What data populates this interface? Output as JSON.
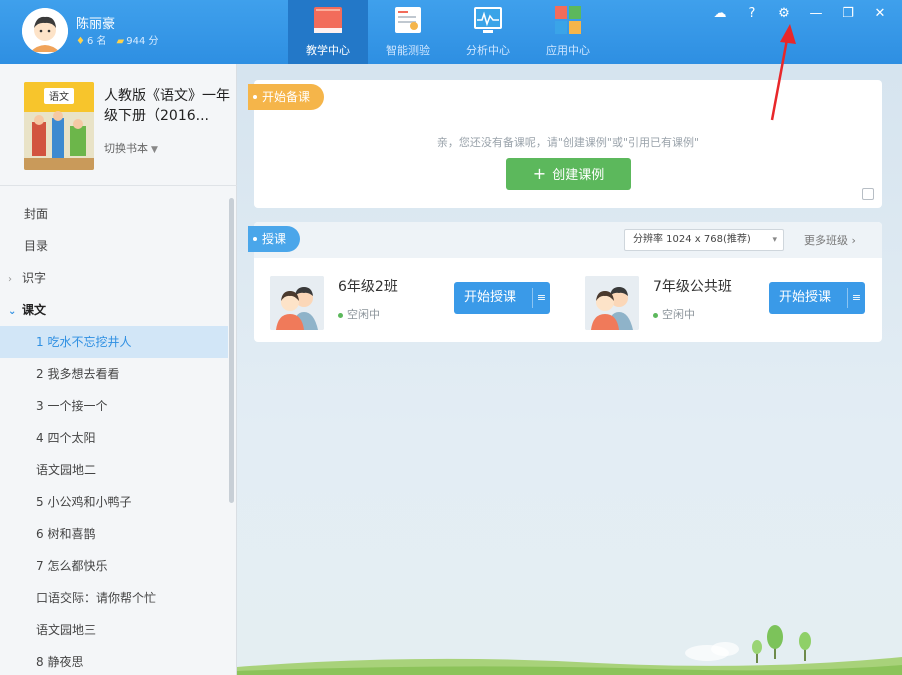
{
  "user": {
    "name": "陈丽豪",
    "stat1": "6 名",
    "stat2": "944 分"
  },
  "nav": [
    {
      "label": "教学中心",
      "active": true
    },
    {
      "label": "智能测验",
      "active": false
    },
    {
      "label": "分析中心",
      "active": false
    },
    {
      "label": "应用中心",
      "active": false
    }
  ],
  "window": {
    "cloud": "☁",
    "help": "?",
    "settings": "⚙",
    "minimize": "—",
    "restore": "❐",
    "close": "✕"
  },
  "book": {
    "title": "人教版《语文》一年级下册（2016...",
    "switch_label": "切换书本",
    "cover_text": "语文"
  },
  "toc": [
    {
      "label": "封面",
      "kind": "plain"
    },
    {
      "label": "目录",
      "kind": "plain"
    },
    {
      "label": "识字",
      "kind": "section",
      "arrow": "›"
    },
    {
      "label": "课文",
      "kind": "section-open",
      "arrow": "⌄"
    },
    {
      "label": "1 吃水不忘挖井人",
      "kind": "lesson-selected"
    },
    {
      "label": "2 我多想去看看",
      "kind": "lesson"
    },
    {
      "label": "3 一个接一个",
      "kind": "lesson"
    },
    {
      "label": "4 四个太阳",
      "kind": "lesson"
    },
    {
      "label": "语文园地二",
      "kind": "lesson"
    },
    {
      "label": "5 小公鸡和小鸭子",
      "kind": "lesson"
    },
    {
      "label": "6 树和喜鹊",
      "kind": "lesson"
    },
    {
      "label": "7 怎么都快乐",
      "kind": "lesson"
    },
    {
      "label": "口语交际：请你帮个忙",
      "kind": "lesson"
    },
    {
      "label": "语文园地三",
      "kind": "lesson"
    },
    {
      "label": "8 静夜思",
      "kind": "lesson"
    }
  ],
  "prep": {
    "ribbon": "开始备课",
    "hint": "亲，您还没有备课呢，请\"创建课例\"或\"引用已有课例\"",
    "create_label": "创建课例",
    "plus": "+"
  },
  "teach": {
    "ribbon": "授课",
    "resolution": "分辨率 1024 x 768(推荐)",
    "resolution_caret": "▾",
    "more_label": "更多班级 ›",
    "classes": [
      {
        "name": "6年级2班",
        "status": "空闲中",
        "button": "开始授课"
      },
      {
        "name": "7年级公共班",
        "status": "空闲中",
        "button": "开始授课"
      }
    ],
    "menu_glyph": "≡"
  },
  "colors": {
    "header": "#2e8fe2",
    "nav_active": "#2378c8",
    "accent": "#3a9ae8",
    "green": "#5cb85c",
    "orange": "#f5b54a",
    "annotation": "#e8272a"
  }
}
